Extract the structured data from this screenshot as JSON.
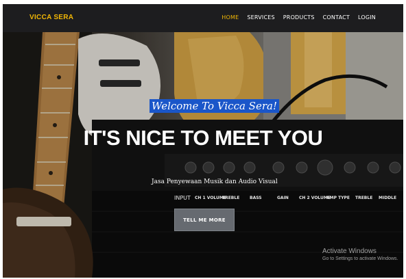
{
  "navbar": {
    "brand": "VICCA SERA",
    "items": [
      {
        "label": "HOME",
        "active": true
      },
      {
        "label": "SERVICES",
        "active": false
      },
      {
        "label": "PRODUCTS",
        "active": false
      },
      {
        "label": "CONTACT",
        "active": false
      },
      {
        "label": "LOGIN",
        "active": false
      }
    ]
  },
  "hero": {
    "welcome": "Welcome To Vicca Sera!",
    "headline": "IT'S NICE TO MEET YOU",
    "subtitle": "Jasa Penyewaan Musik dan Audio Visual",
    "button_label": "TELL ME MORE"
  },
  "amp_panel": {
    "labels": [
      "INPUT",
      "CH 1 VOLUME",
      "TREBLE",
      "BASS",
      "GAIN",
      "CH 2 VOLUME",
      "AMP TYPE",
      "TREBLE",
      "MIDDLE"
    ]
  },
  "watermark": {
    "title": "Activate Windows",
    "subtitle": "Go to Settings to activate Windows."
  },
  "colors": {
    "accent": "#f2b705",
    "navbar_bg": "#1d1d1f",
    "welcome_highlight": "#1a56c9",
    "button_bg": "#666a70"
  }
}
